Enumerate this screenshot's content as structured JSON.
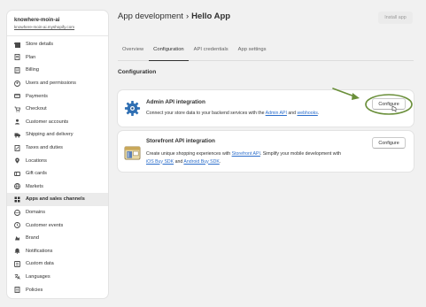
{
  "store": {
    "name": "knowhere-moin-ai",
    "url": "knowhere-moin-ai.myshopify.com"
  },
  "sidebar": {
    "items": [
      {
        "label": "Store details",
        "icon": "store-icon"
      },
      {
        "label": "Plan",
        "icon": "plan-icon"
      },
      {
        "label": "Billing",
        "icon": "billing-icon"
      },
      {
        "label": "Users and permissions",
        "icon": "users-icon"
      },
      {
        "label": "Payments",
        "icon": "payments-icon"
      },
      {
        "label": "Checkout",
        "icon": "checkout-icon"
      },
      {
        "label": "Customer accounts",
        "icon": "customer-accounts-icon"
      },
      {
        "label": "Shipping and delivery",
        "icon": "shipping-icon"
      },
      {
        "label": "Taxes and duties",
        "icon": "taxes-icon"
      },
      {
        "label": "Locations",
        "icon": "location-icon"
      },
      {
        "label": "Gift cards",
        "icon": "gift-card-icon"
      },
      {
        "label": "Markets",
        "icon": "globe-icon"
      },
      {
        "label": "Apps and sales channels",
        "icon": "apps-icon",
        "active": true
      },
      {
        "label": "Domains",
        "icon": "domains-icon"
      },
      {
        "label": "Customer events",
        "icon": "customer-events-icon"
      },
      {
        "label": "Brand",
        "icon": "brand-icon"
      },
      {
        "label": "Notifications",
        "icon": "bell-icon"
      },
      {
        "label": "Custom data",
        "icon": "custom-data-icon"
      },
      {
        "label": "Languages",
        "icon": "languages-icon"
      },
      {
        "label": "Policies",
        "icon": "policies-icon"
      }
    ]
  },
  "header": {
    "breadcrumb": "App development",
    "separator": "›",
    "title": "Hello App",
    "install_label": "Install app"
  },
  "tabs": [
    {
      "label": "Overview"
    },
    {
      "label": "Configuration",
      "active": true
    },
    {
      "label": "API credentials"
    },
    {
      "label": "App settings"
    }
  ],
  "section_title": "Configuration",
  "admin_card": {
    "title": "Admin API integration",
    "desc_prefix": "Connect your store data to your backend services with the ",
    "link1": "Admin API",
    "desc_mid": " and ",
    "link2": "webhooks",
    "desc_suffix": ".",
    "button": "Configure",
    "icon": "gear-icon"
  },
  "storefront_card": {
    "title": "Storefront API integration",
    "line1_prefix": "Create unique shopping experiences with ",
    "line1_link": "Storefront API",
    "line1_suffix": ". Simplify your mobile development with",
    "line2_link1": "iOS Buy SDK",
    "line2_mid": " and ",
    "line2_link2": "Android Buy SDK",
    "line2_suffix": ".",
    "button": "Configure",
    "icon": "storefront-icon"
  },
  "colors": {
    "accent_link": "#2c6ecb",
    "annotation_green": "#6a8f3a"
  }
}
